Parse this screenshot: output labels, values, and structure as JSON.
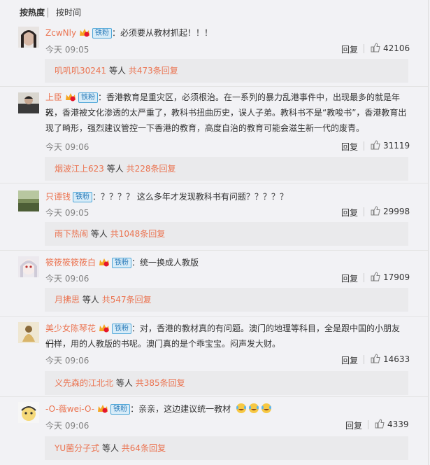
{
  "sort": {
    "hot": "按热度",
    "time": "按时间"
  },
  "comments": [
    {
      "user": "ZcwNly",
      "fan_badge": "铁粉",
      "text": "：必须要从教材抓起！！！",
      "time": "今天 09:05",
      "reply": "回复",
      "likes": "42106",
      "reply_user": "叽叽叽30241",
      "reply_mid": "等人",
      "reply_count": "共473条回复"
    },
    {
      "user": "上臣",
      "fan_badge": "铁粉",
      "text_line1": "：香港教育是重灾区，必须根治。在一系列的暴力乱港事件中，出现最多的就是年轻",
      "text_line2": "人，香港被文化渗透的太严重了，教科书扭曲历史，误人子弟。教科书不是“教唆书”，香港教育出",
      "text_line3": "现了畸形，强烈建议管控一下香港的教育，高度自治的教育可能会滋生新一代的废青。",
      "time": "今天 09:06",
      "reply": "回复",
      "likes": "31119",
      "reply_user": "烟波江上623",
      "reply_mid": "等人",
      "reply_count": "共228条回复"
    },
    {
      "user": "只谭钱",
      "fan_badge": "铁粉",
      "text": "：？？？？ 这么多年才发现教科书有问题？？？？？",
      "time": "今天 09:05",
      "reply": "回复",
      "likes": "29998",
      "reply_user": "雨下热闹",
      "reply_mid": "等人",
      "reply_count": "共1048条回复"
    },
    {
      "user": "筱筱筱筱筱白",
      "fan_badge": "铁粉",
      "text": "：统一换成人教版",
      "time": "今天 09:06",
      "reply": "回复",
      "likes": "17909",
      "reply_user": "月拂思",
      "reply_mid": "等人",
      "reply_count": "共547条回复"
    },
    {
      "user": "美少女陈琴花",
      "fan_badge": "铁粉",
      "text_line1": "：对，香港的教材真的有问题。澳门的地理等科目，全是跟中国的小朋友们",
      "text_line2": "一样，用的人教版的书呢。澳门真的是个乖宝宝。闷声发大财。",
      "time": "今天 09:06",
      "reply": "回复",
      "likes": "14633",
      "reply_user": "义先森的江北北",
      "reply_mid": "等人",
      "reply_count": "共385条回复"
    },
    {
      "user": "-O-薇wei-O-",
      "fan_badge": "铁粉",
      "text": "：亲亲，这边建议统一教材",
      "time": "今天 09:06",
      "reply": "回复",
      "likes": "4339",
      "reply_user": "YU菌分子式",
      "reply_mid": "等人",
      "reply_count": "共64条回复"
    }
  ],
  "colors": {
    "username": "#eb7350",
    "fan_badge_bg": "#d8ecf8",
    "fan_badge_text": "#2b7bb9"
  }
}
